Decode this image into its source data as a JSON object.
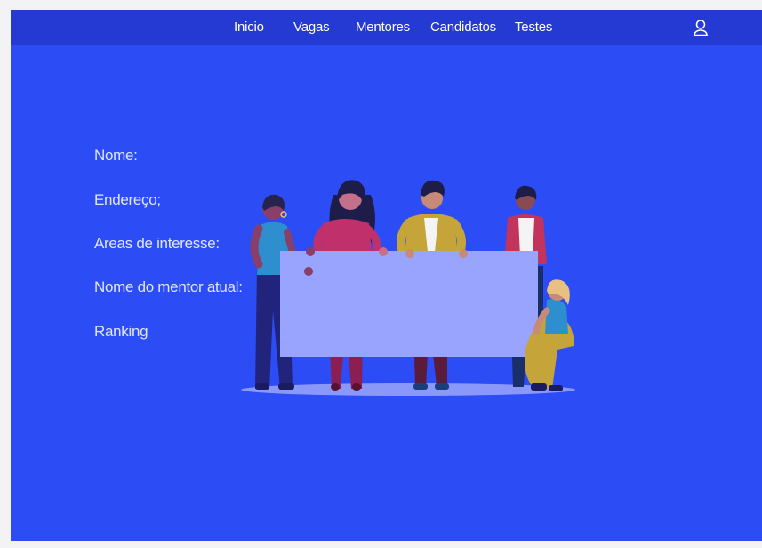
{
  "navbar": {
    "links": [
      {
        "label": "Inicio"
      },
      {
        "label": "Vagas"
      },
      {
        "label": "Mentores"
      },
      {
        "label": "Candidatos"
      },
      {
        "label": "Testes"
      }
    ],
    "user_icon": "user-icon"
  },
  "profile": {
    "fields": [
      {
        "label": "Nome:"
      },
      {
        "label": "Endereço;"
      },
      {
        "label": "Areas de interesse:"
      },
      {
        "label": "Nome do mentor atual:"
      },
      {
        "label": "Ranking"
      }
    ]
  },
  "illustration": {
    "name": "people-holding-banner-illustration"
  },
  "colors": {
    "page_background": "#f3f3f6",
    "app_background": "#2c4cf5",
    "navbar_background": "#2539d3",
    "banner": "#98a4fe",
    "text": "#dfe6ff"
  }
}
